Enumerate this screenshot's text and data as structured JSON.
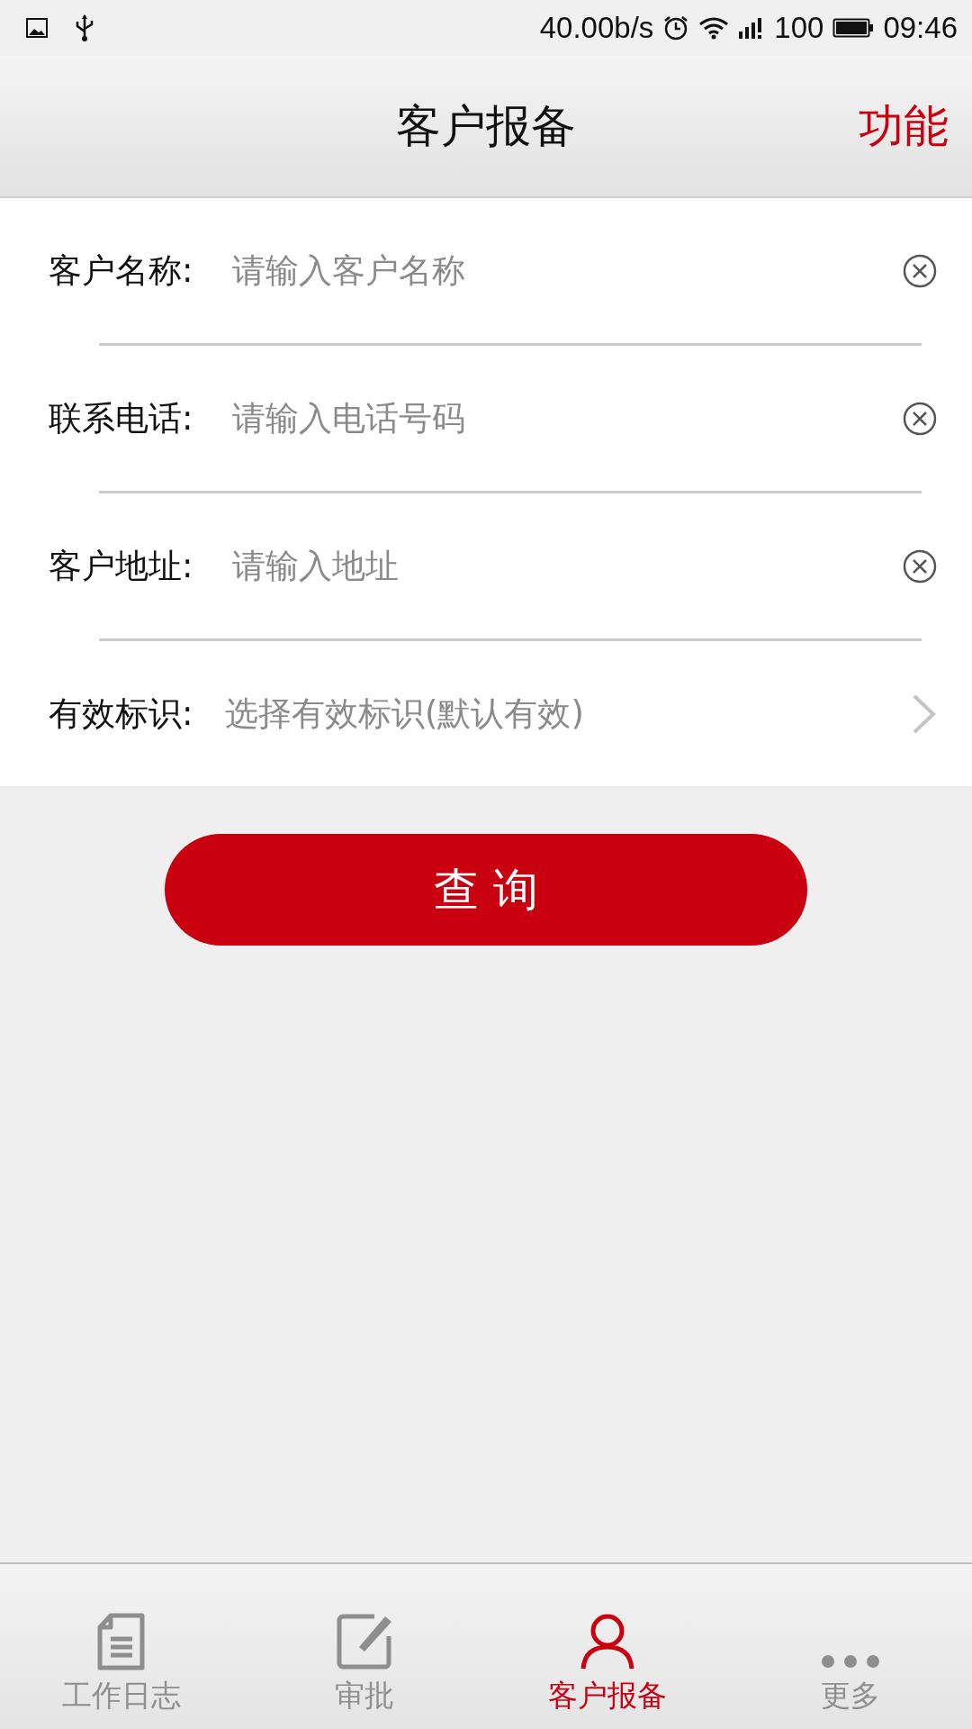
{
  "status_bar": {
    "speed": "40.00b/s",
    "battery": "100",
    "time": "09:46"
  },
  "header": {
    "title": "客户报备",
    "action": "功能"
  },
  "fields": [
    {
      "kind": "input",
      "label": "客户名称:",
      "placeholder": "请输入客户名称"
    },
    {
      "kind": "input",
      "label": "联系电话:",
      "placeholder": "请输入电话号码"
    },
    {
      "kind": "input",
      "label": "客户地址:",
      "placeholder": "请输入地址"
    },
    {
      "kind": "select",
      "label": "有效标识:",
      "placeholder": "选择有效标识(默认有效)"
    }
  ],
  "search_button": "查 询",
  "tabs": [
    {
      "kind": "log",
      "label": "工作日志",
      "selected": false
    },
    {
      "kind": "approve",
      "label": "审批",
      "selected": false
    },
    {
      "kind": "customer",
      "label": "客户报备",
      "selected": true
    },
    {
      "kind": "more",
      "label": "更多",
      "selected": false
    }
  ]
}
